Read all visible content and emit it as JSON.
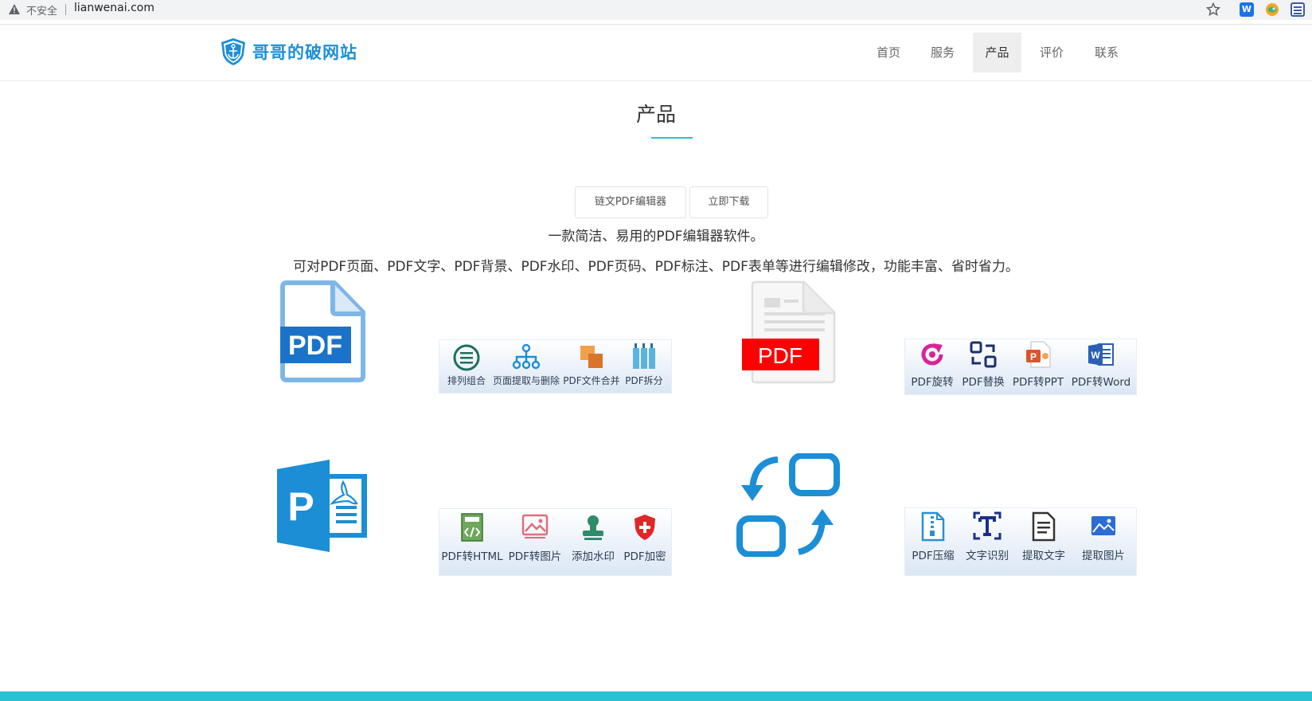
{
  "browser": {
    "security_label": "不安全",
    "url": "lianwenai.com",
    "extension_w_label": "W"
  },
  "header": {
    "logo_text": "哥哥的破网站",
    "nav": [
      {
        "label": "首页",
        "active": false
      },
      {
        "label": "服务",
        "active": false
      },
      {
        "label": "产品",
        "active": true
      },
      {
        "label": "评价",
        "active": false
      },
      {
        "label": "联系",
        "active": false
      }
    ]
  },
  "section": {
    "title": "产品",
    "tabs": [
      {
        "label": "链文PDF编辑器"
      },
      {
        "label": "立即下载"
      }
    ],
    "tagline": "一款简洁、易用的PDF编辑器软件。",
    "description": "可对PDF页面、PDF文字、PDF背景、PDF水印、PDF页码、PDF标注、PDF表单等进行编辑修改，功能丰富、省时省力。"
  },
  "big_icons": {
    "pdf_file_label": "PDF",
    "pdf_red_label": "PDF",
    "publisher_letter": "P"
  },
  "panels": {
    "page_tools": [
      {
        "label": "排列组合",
        "icon": "arrange-icon"
      },
      {
        "label": "页面提取与删除",
        "icon": "hierarchy-icon"
      },
      {
        "label": "PDF文件合并",
        "icon": "merge-icon"
      },
      {
        "label": "PDF拆分",
        "icon": "split-icon"
      }
    ],
    "convert_tools": [
      {
        "label": "PDF旋转",
        "icon": "rotate-icon"
      },
      {
        "label": "PDF替换",
        "icon": "replace-icon"
      },
      {
        "label": "PDF转PPT",
        "icon": "ppt-icon"
      },
      {
        "label": "PDF转Word",
        "icon": "word-icon"
      }
    ],
    "export_tools": [
      {
        "label": "PDF转HTML",
        "icon": "html-icon"
      },
      {
        "label": "PDF转图片",
        "icon": "image-icon"
      },
      {
        "label": "添加水印",
        "icon": "stamp-icon"
      },
      {
        "label": "PDF加密",
        "icon": "shield-icon"
      }
    ],
    "extract_tools": [
      {
        "label": "PDF压缩",
        "icon": "zip-icon"
      },
      {
        "label": "文字识别",
        "icon": "ocr-icon"
      },
      {
        "label": "提取文字",
        "icon": "text-doc-icon"
      },
      {
        "label": "提取图片",
        "icon": "picture-icon"
      }
    ]
  },
  "colors": {
    "accent": "#2dc1d3",
    "brand_blue": "#1d8fd6",
    "pdf_red": "#ff0000",
    "footer": "#2cc0d4"
  }
}
